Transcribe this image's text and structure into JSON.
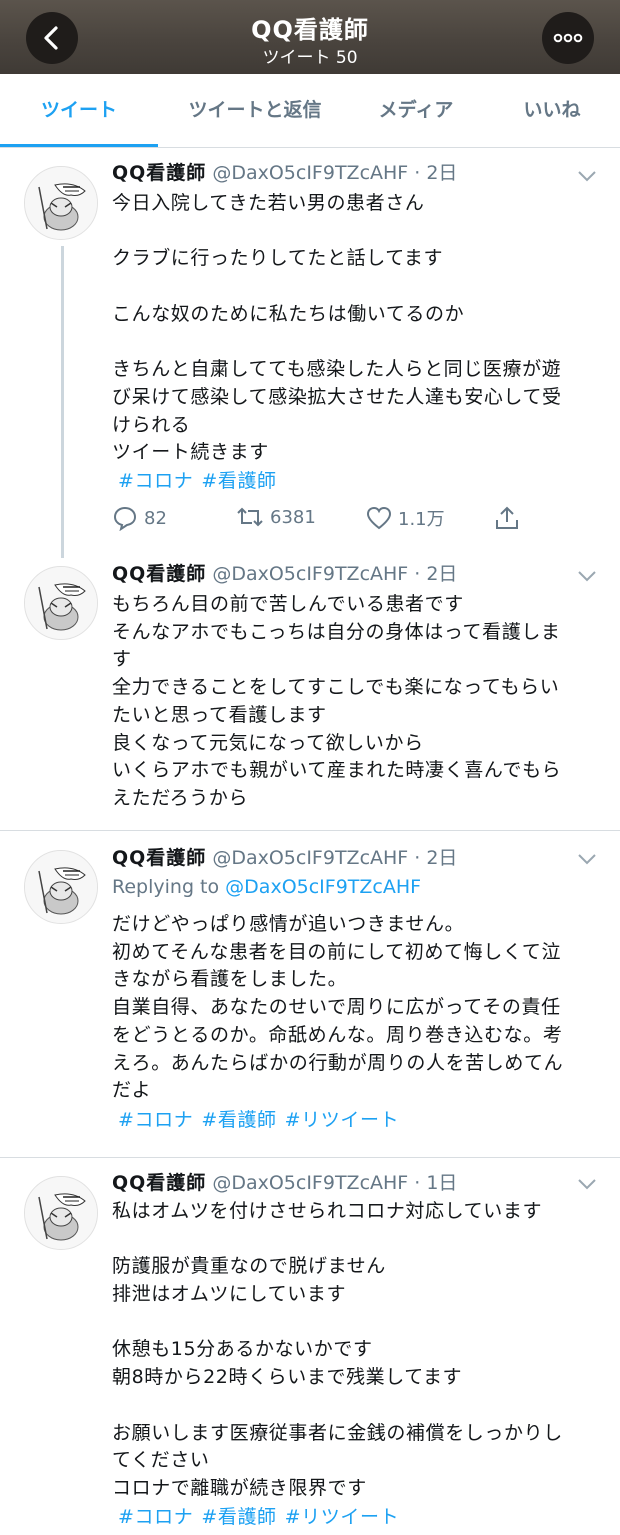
{
  "header": {
    "title": "QQ看護師",
    "subtitle": "ツイート 50"
  },
  "tabs": [
    "ツイート",
    "ツイートと返信",
    "メディア",
    "いいね"
  ],
  "colors": {
    "accent": "#1da1f2",
    "muted": "#657786",
    "header_bg": "#4a443e"
  },
  "tweets": [
    {
      "name": "QQ看護師",
      "handle": "@DaxO5cIF9TZcAHF · 2日",
      "lines": [
        "今日入院してきた若い男の患者さん",
        "",
        "クラブに行ったりしてたと話してます",
        "",
        "こんな奴のために私たちは働いてるのか",
        "",
        "きちんと自粛してても感染した人らと同じ医療が遊",
        "び呆けて感染して感染拡大させた人達も安心して受",
        "けられる",
        "ツイート続きます"
      ],
      "hashtags": [
        "#コロナ",
        "#看護師"
      ],
      "stats": {
        "replies": "82",
        "retweets": "6381",
        "likes": "1.1万"
      }
    },
    {
      "name": "QQ看護師",
      "handle": "@DaxO5cIF9TZcAHF · 2日",
      "lines": [
        "もちろん目の前で苦しんでいる患者です",
        "そんなアホでもこっちは自分の身体はって看護しま",
        "す",
        "全力できることをしてすこしでも楽になってもらい",
        "たいと思って看護します",
        "良くなって元気になって欲しいから",
        "いくらアホでも親がいて産まれた時凄く喜んでもら",
        "えただろうから"
      ]
    },
    {
      "name": "QQ看護師",
      "handle": "@DaxO5cIF9TZcAHF · 2日",
      "replying_label": "Replying to",
      "replying_handle": "@DaxO5cIF9TZcAHF",
      "lines": [
        "だけどやっぱり感情が追いつきません。",
        "初めてそんな患者を目の前にして初めて悔しくて泣",
        "きながら看護をしました。",
        "自業自得、あなたのせいで周りに広がってその責任",
        "をどうとるのか。命舐めんな。周り巻き込むな。考",
        "えろ。あんたらばかの行動が周りの人を苦しめてん",
        "だよ"
      ],
      "hashtags": [
        "#コロナ",
        "#看護師",
        "#リツイート"
      ]
    },
    {
      "name": "QQ看護師",
      "handle": "@DaxO5cIF9TZcAHF · 1日",
      "lines": [
        "私はオムツを付けさせられコロナ対応しています",
        "",
        "防護服が貴重なので脱げません",
        "排泄はオムツにしています",
        "",
        "休憩も15分あるかないかです",
        "朝8時から22時くらいまで残業してます",
        "",
        "お願いします医療従事者に金銭の補償をしっかりし",
        "てください",
        "コロナで離職が続き限界です"
      ],
      "hashtags": [
        "#コロナ",
        "#看護師",
        "#リツイート"
      ]
    }
  ]
}
